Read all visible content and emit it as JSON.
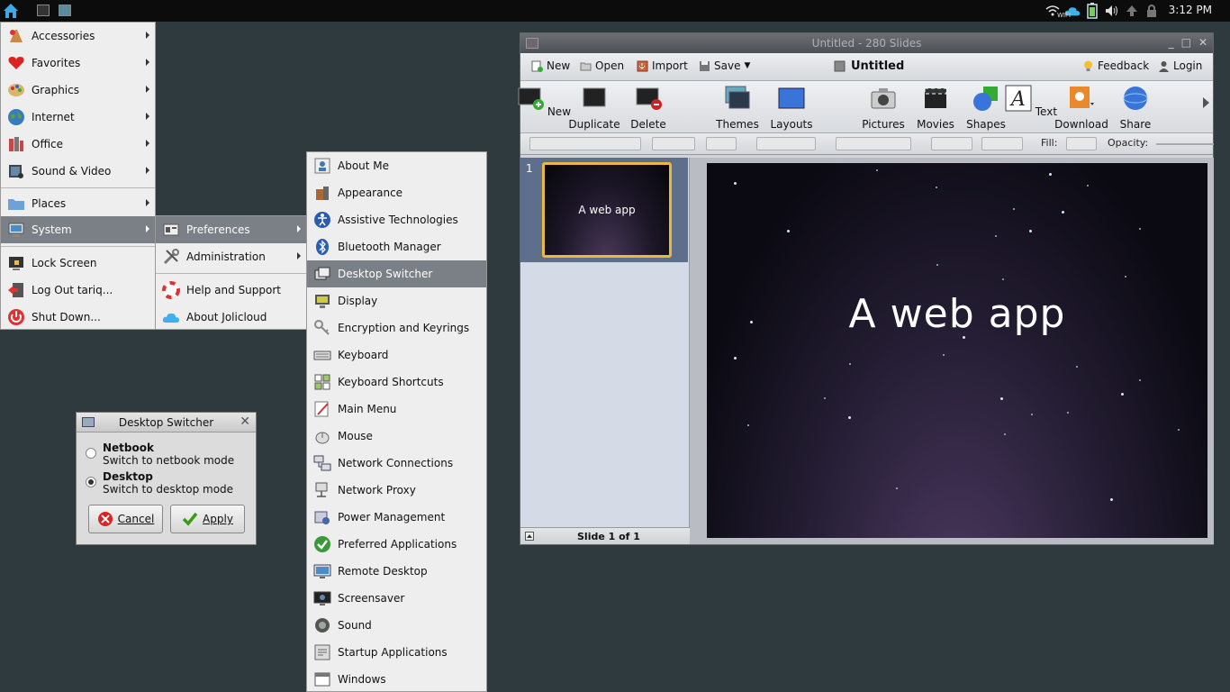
{
  "panel": {
    "clock": "3:12 PM",
    "wifi_label": "WIFI"
  },
  "main_menu": {
    "items": [
      "Accessories",
      "Favorites",
      "Graphics",
      "Internet",
      "Office",
      "Sound & Video",
      "Places",
      "System",
      "Lock Screen",
      "Log Out tariq...",
      "Shut Down..."
    ]
  },
  "system_menu": {
    "items": [
      "Preferences",
      "Administration",
      "Help and Support",
      "About Jolicloud"
    ]
  },
  "preferences_menu": {
    "items": [
      "About Me",
      "Appearance",
      "Assistive Technologies",
      "Bluetooth Manager",
      "Desktop Switcher",
      "Display",
      "Encryption and Keyrings",
      "Keyboard",
      "Keyboard Shortcuts",
      "Main Menu",
      "Mouse",
      "Network Connections",
      "Network Proxy",
      "Power Management",
      "Preferred Applications",
      "Remote Desktop",
      "Screensaver",
      "Sound",
      "Startup Applications",
      "Windows"
    ]
  },
  "dialog": {
    "title": "Desktop Switcher",
    "options": [
      {
        "label": "Netbook",
        "desc": "Switch to netbook mode",
        "selected": false
      },
      {
        "label": "Desktop",
        "desc": "Switch to desktop mode",
        "selected": true
      }
    ],
    "cancel": "Cancel",
    "apply": "Apply"
  },
  "slides_window": {
    "title": "Untitled - 280 Slides",
    "menubar": {
      "new": "New",
      "open": "Open",
      "import": "Import",
      "save": "Save",
      "doc_title": "Untitled",
      "feedback": "Feedback",
      "login": "Login"
    },
    "toolbar": [
      "New",
      "Duplicate",
      "Delete",
      "Themes",
      "Layouts",
      "Pictures",
      "Movies",
      "Shapes",
      "Text",
      "Download",
      "Share"
    ],
    "format": {
      "fill": "Fill:",
      "opacity": "Opacity:"
    },
    "slide_number": "1",
    "thumb_text": "A web app",
    "status": "Slide 1 of 1",
    "slide_title": "A web app"
  },
  "colors": {
    "desktop": "#2f3a3f",
    "menu_highlight": "#7b8087",
    "thumb_border": "#e8b93a"
  }
}
